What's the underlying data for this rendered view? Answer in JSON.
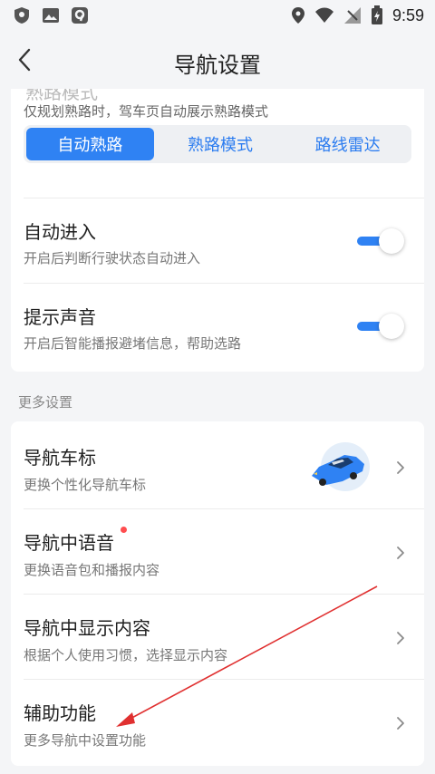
{
  "status_bar": {
    "time": "9:59",
    "left_icons": [
      "shield-icon",
      "image-icon",
      "app-badge-icon"
    ],
    "right_icons": [
      "location-icon",
      "wifi-icon",
      "signal-icon",
      "battery-icon"
    ]
  },
  "header": {
    "title": "导航设置",
    "back_icon": "back-chevron-icon"
  },
  "card1": {
    "clipped_title": "熟路模式",
    "hint": "仅规划熟路时，驾车页自动展示熟路模式",
    "segments": [
      {
        "label": "自动熟路",
        "active": true
      },
      {
        "label": "熟路模式",
        "active": false
      },
      {
        "label": "路线雷达",
        "active": false
      }
    ],
    "rows": [
      {
        "title": "自动进入",
        "subtitle": "开启后判断行驶状态自动进入",
        "enabled": true
      },
      {
        "title": "提示声音",
        "subtitle": "开启后智能播报避堵信息，帮助选路",
        "enabled": true
      }
    ]
  },
  "section_label": "更多设置",
  "card2": {
    "rows": [
      {
        "title": "导航车标",
        "subtitle": "更换个性化导航车标",
        "thumb_icon": "blue-car-icon"
      },
      {
        "title": "导航中语音",
        "subtitle": "更换语音包和播报内容",
        "badge": "red-dot"
      },
      {
        "title": "导航中显示内容",
        "subtitle": "根据个人使用习惯，选择显示内容"
      },
      {
        "title": "辅助功能",
        "subtitle": "更多导航中设置功能"
      }
    ]
  },
  "colors": {
    "accent": "#2f82f3",
    "background": "#f4f5f7",
    "annotation_arrow": "#e03030",
    "badge": "#ff4d4f"
  }
}
